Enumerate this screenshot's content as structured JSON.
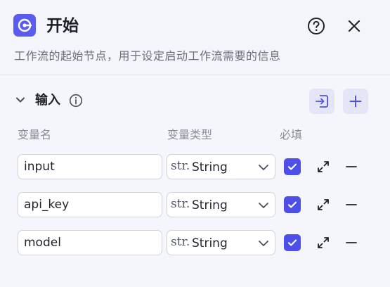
{
  "node": {
    "icon": "start-node-icon",
    "title": "开始",
    "description": "工作流的起始节点，用于设定启动工作流需要的信息",
    "accent_color": "#5a5cf0"
  },
  "header_actions": {
    "help_icon": "question-circle-icon",
    "close_icon": "close-icon"
  },
  "inputs_section": {
    "title": "输入",
    "info_icon": "info-icon",
    "import_icon": "import-icon",
    "add_icon": "plus-icon",
    "columns": {
      "name": "变量名",
      "type": "变量类型",
      "required": "必填"
    },
    "rows": [
      {
        "name": "input",
        "type_icon": "str.",
        "type": "String",
        "required": true
      },
      {
        "name": "api_key",
        "type_icon": "str.",
        "type": "String",
        "required": true
      },
      {
        "name": "model",
        "type_icon": "str.",
        "type": "String",
        "required": true
      }
    ]
  }
}
